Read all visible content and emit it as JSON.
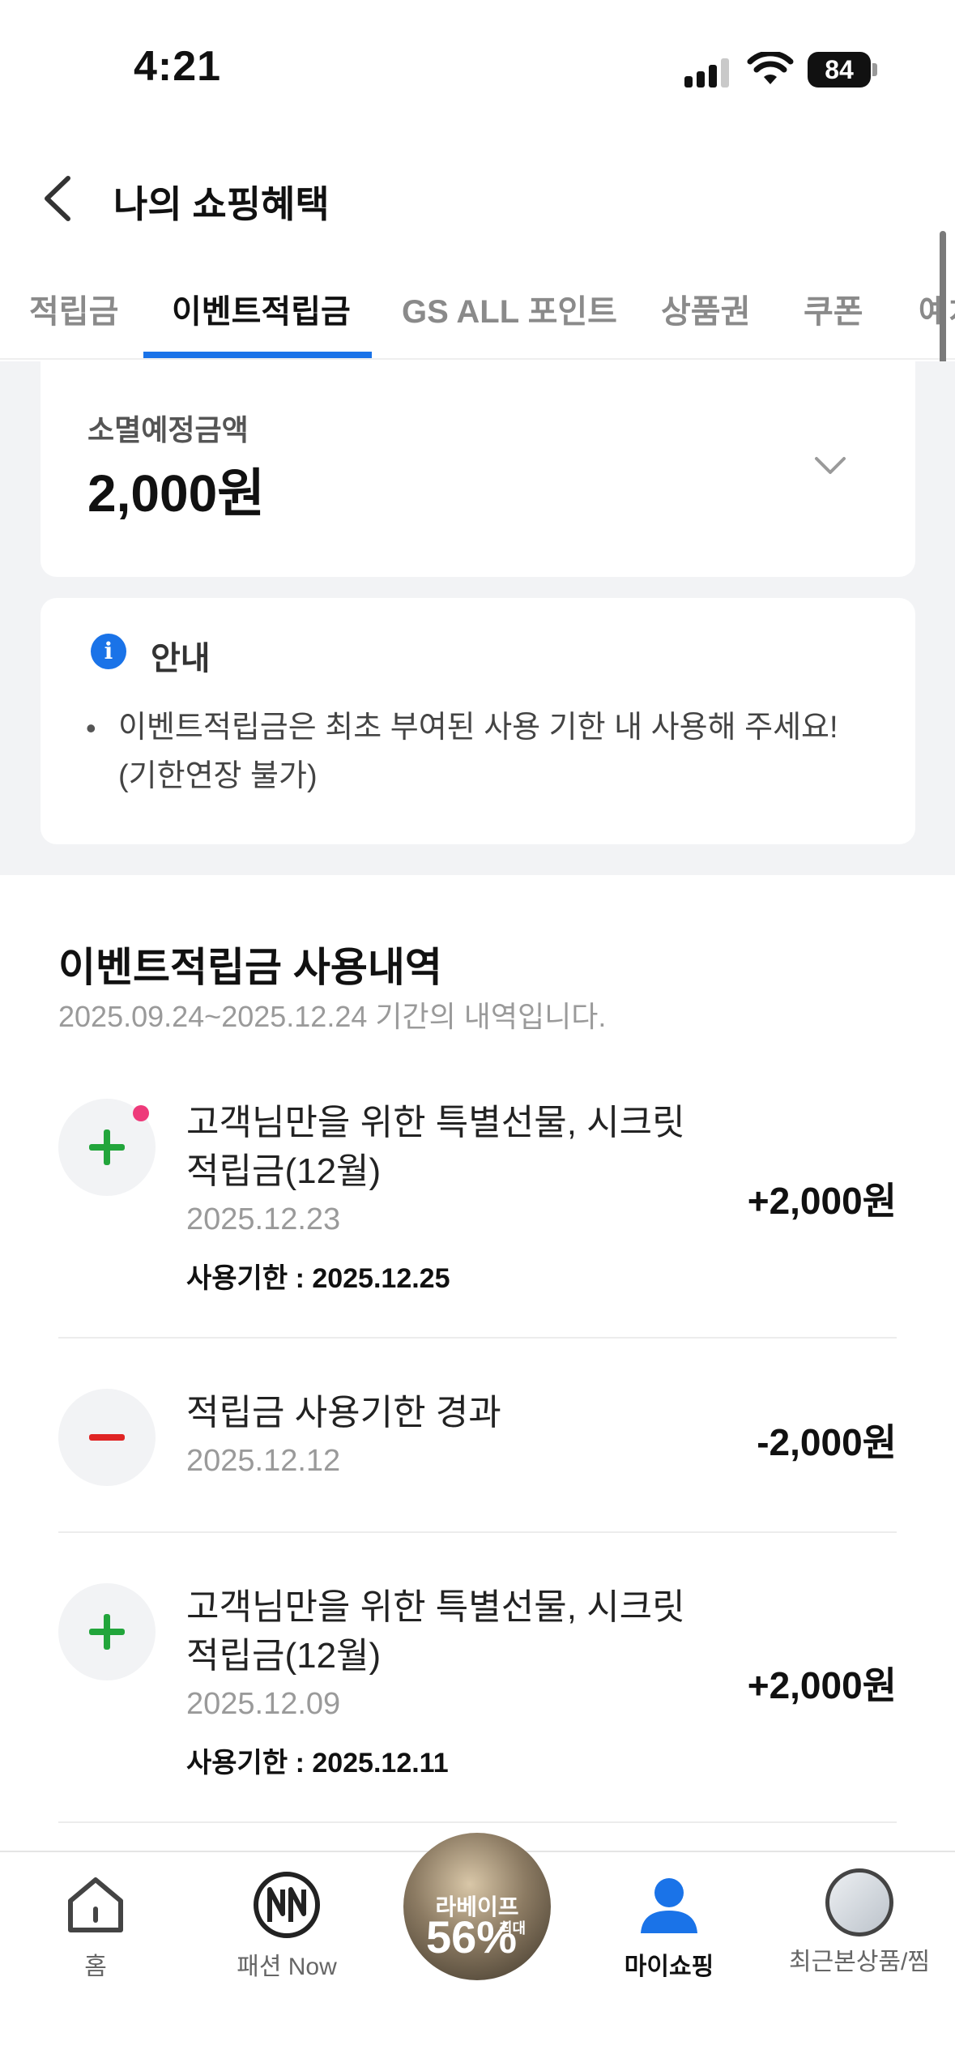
{
  "status_bar": {
    "time": "4:21",
    "battery": "84"
  },
  "header": {
    "title": "나의 쇼핑혜택"
  },
  "tabs": [
    {
      "label": "적립금"
    },
    {
      "label": "이벤트적립금"
    },
    {
      "label": "GS ALL 포인트"
    },
    {
      "label": "상품권"
    },
    {
      "label": "쿠폰"
    },
    {
      "label": "예치"
    }
  ],
  "active_tab": "이벤트적립금",
  "expire": {
    "label": "소멸예정금액",
    "value": "2,000원"
  },
  "notice": {
    "title": "안내",
    "bullet": "•",
    "text": "이벤트적립금은 최초 부여된 사용 기한 내 사용해 주세요! (기한연장 불가)"
  },
  "history": {
    "title": "이벤트적립금 사용내역",
    "period": "2025.09.24~2025.12.24 기간의 내역입니다.",
    "items": [
      {
        "type": "plus",
        "title": "고객님만을 위한 특별선물, 시크릿 적립금(12월)",
        "date": "2025.12.23",
        "expire": "사용기한 : 2025.12.25",
        "amount": "+2,000원",
        "new": true
      },
      {
        "type": "minus",
        "title": "적립금 사용기한 경과",
        "date": "2025.12.12",
        "expire": "",
        "amount": "-2,000원",
        "new": false
      },
      {
        "type": "plus",
        "title": "고객님만을 위한 특별선물, 시크릿 적립금(12월)",
        "date": "2025.12.09",
        "expire": "사용기한 : 2025.12.11",
        "amount": "+2,000원",
        "new": false
      }
    ]
  },
  "bottom_nav": {
    "items": [
      {
        "label": "홈",
        "icon": "home-icon"
      },
      {
        "label": "패션 Now",
        "icon": "fashion-now-icon"
      },
      {
        "label": "",
        "icon": "promo-banner"
      },
      {
        "label": "마이쇼핑",
        "icon": "person-icon"
      },
      {
        "label": "최근본상품/찜",
        "icon": "recent-product-thumbnail"
      }
    ],
    "promo": {
      "line1": "라베이프",
      "line2": "56%",
      "line3": "최대"
    }
  },
  "colors": {
    "accent": "#1a73e8",
    "plus": "#22a53b",
    "minus": "#e02424",
    "dot": "#ee3a7a"
  }
}
